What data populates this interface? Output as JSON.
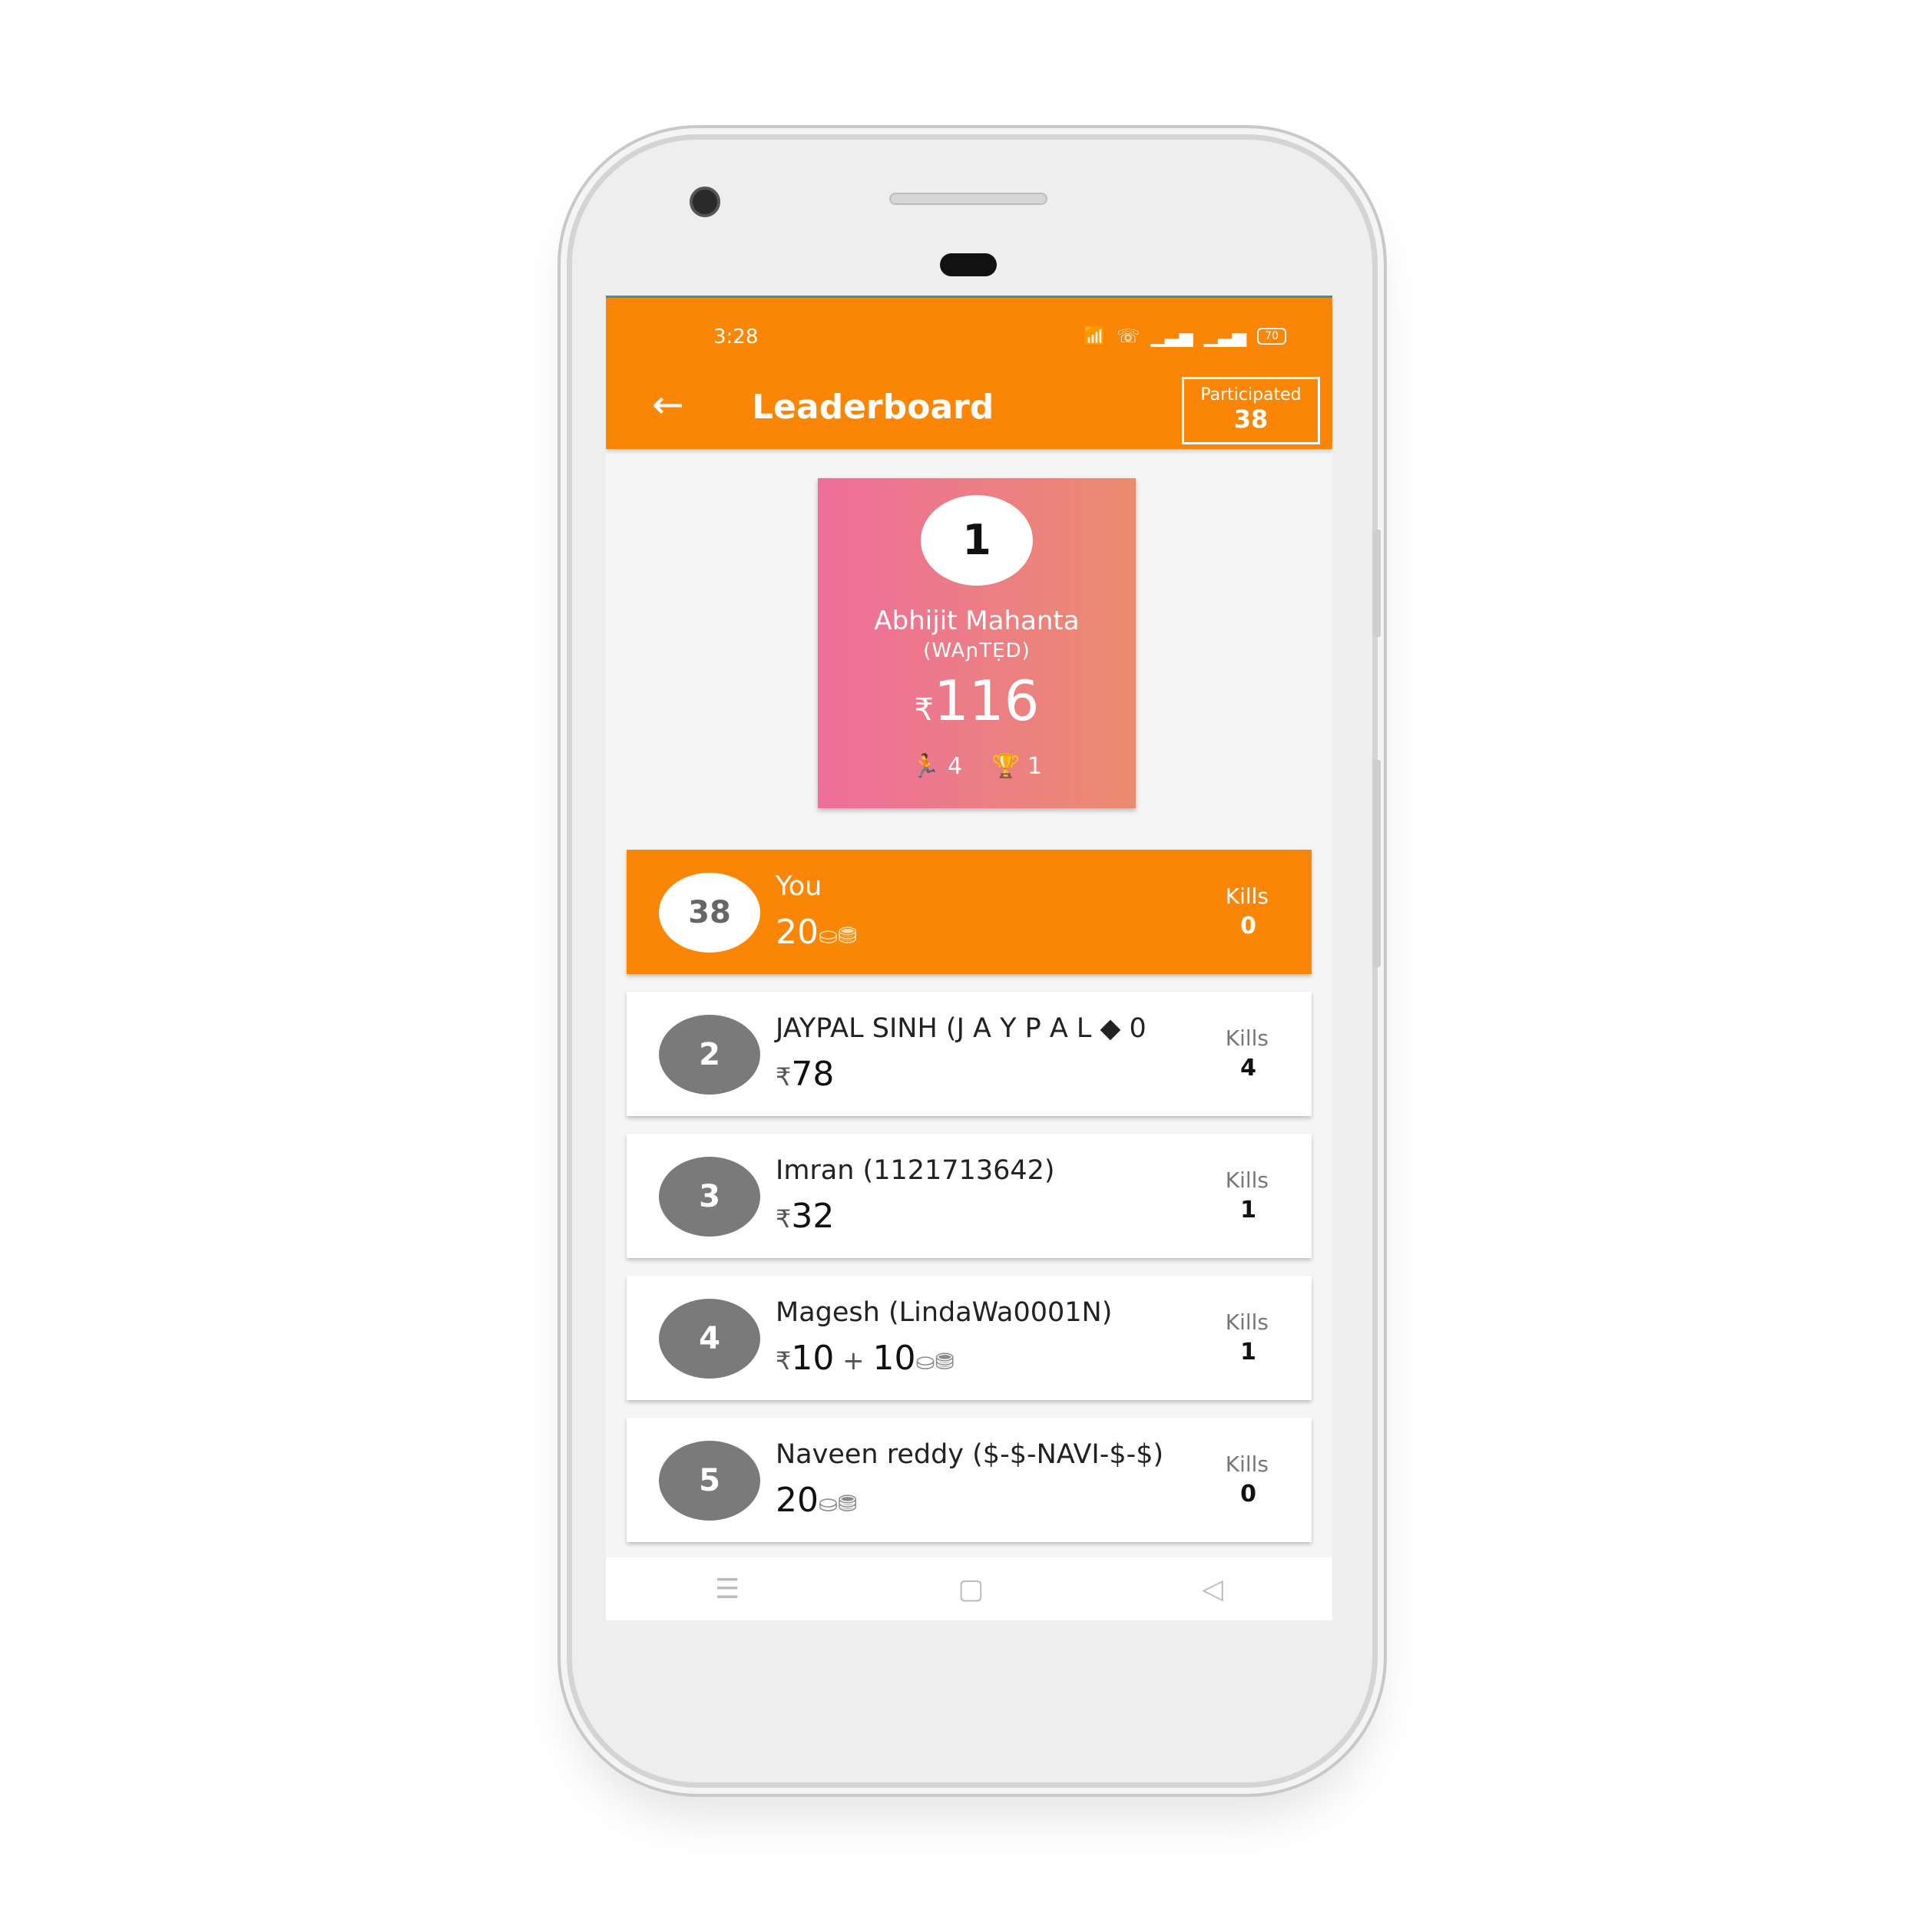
{
  "status_bar": {
    "time": "3:28",
    "wifi_icon": "wifi-icon",
    "call_icon": "wifi-call-icon",
    "signal_icon": "signal-icon",
    "battery": "70"
  },
  "header": {
    "title": "Leaderboard",
    "participated_label": "Participated",
    "participated_count": "38"
  },
  "top_player": {
    "rank": "1",
    "name": "Abhijit Mahanta",
    "tag": "(WAɲTẸD)",
    "currency": "₹",
    "amount": "116",
    "kills": "4",
    "wins": "1"
  },
  "rows": [
    {
      "rank": "38",
      "name": "You",
      "currency": "",
      "amount": "20",
      "plus": "",
      "amount2": "",
      "coins": "⛀⛃",
      "kills_label": "Kills",
      "kills": "0"
    },
    {
      "rank": "2",
      "name": "JAYPAL SINH (J A Y P A L ◆ 0",
      "currency": "₹",
      "amount": "78",
      "plus": "",
      "amount2": "",
      "coins": "",
      "kills_label": "Kills",
      "kills": "4"
    },
    {
      "rank": "3",
      "name": "Imran (1121713642)",
      "currency": "₹",
      "amount": "32",
      "plus": "",
      "amount2": "",
      "coins": "",
      "kills_label": "Kills",
      "kills": "1"
    },
    {
      "rank": "4",
      "name": "Magesh (LindaWa0001N)",
      "currency": "₹",
      "amount": "10",
      "plus": " + ",
      "amount2": "10",
      "coins": "⛀⛃",
      "kills_label": "Kills",
      "kills": "1"
    },
    {
      "rank": "5",
      "name": "Naveen reddy ($-$-NAVI-$-$)",
      "currency": "",
      "amount": "20",
      "plus": "",
      "amount2": "",
      "coins": "⛀⛃",
      "kills_label": "Kills",
      "kills": "0"
    }
  ],
  "colors": {
    "accent": "#fb8605",
    "card_gradient_start": "#ee6e9c",
    "card_gradient_end": "#ea8c6f",
    "rank_badge": "#7a7a7a"
  }
}
